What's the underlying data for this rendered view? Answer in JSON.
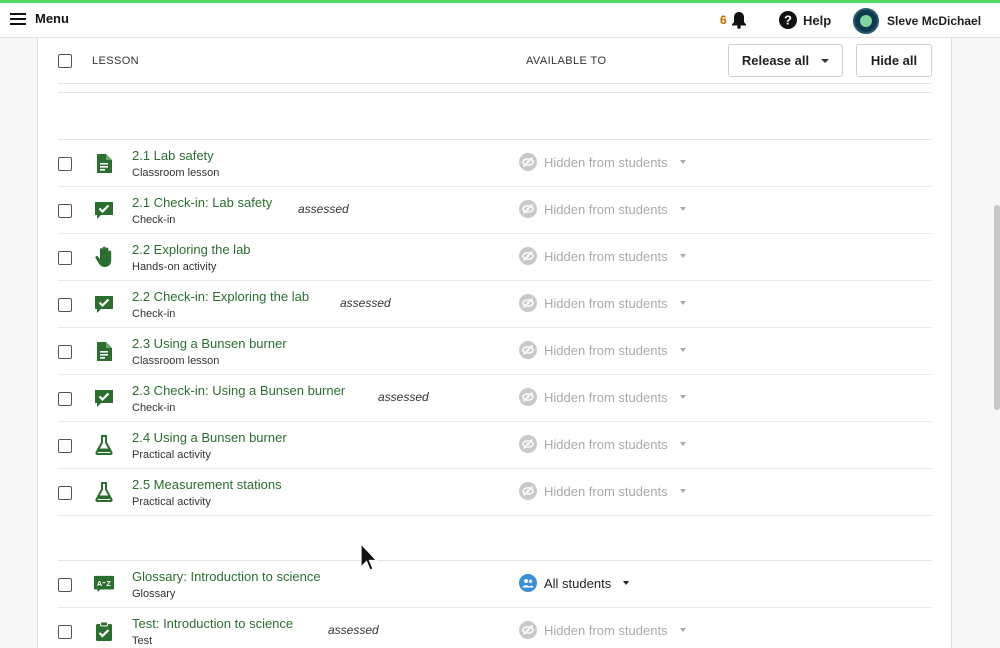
{
  "topbar": {
    "menu_label": "Menu",
    "notification_count": "6",
    "help_label": "Help",
    "user_name": "Sleve McDichael"
  },
  "table": {
    "col_lesson": "LESSON",
    "col_available": "AVAILABLE TO",
    "release_all_label": "Release all",
    "hide_all_label": "Hide all"
  },
  "rows": [
    {
      "title": "2.1 Lab safety",
      "subtitle": "Classroom lesson",
      "icon": "document-icon",
      "assessed": "",
      "status": "Hidden from students"
    },
    {
      "title": "2.1 Check-in: Lab safety",
      "subtitle": "Check-in",
      "icon": "check-in-icon",
      "assessed": "assessed",
      "status": "Hidden from students"
    },
    {
      "title": "2.2 Exploring the lab",
      "subtitle": "Hands-on activity",
      "icon": "hand-icon",
      "assessed": "",
      "status": "Hidden from students"
    },
    {
      "title": "2.2 Check-in: Exploring the lab",
      "subtitle": "Check-in",
      "icon": "check-in-icon",
      "assessed": "assessed",
      "status": "Hidden from students"
    },
    {
      "title": "2.3 Using a Bunsen burner",
      "subtitle": "Classroom lesson",
      "icon": "document-icon",
      "assessed": "",
      "status": "Hidden from students"
    },
    {
      "title": "2.3 Check-in: Using a Bunsen burner",
      "subtitle": "Check-in",
      "icon": "check-in-icon",
      "assessed": "assessed",
      "status": "Hidden from students"
    },
    {
      "title": "2.4 Using a Bunsen burner",
      "subtitle": "Practical activity",
      "icon": "flask-icon",
      "assessed": "",
      "status": "Hidden from students"
    },
    {
      "title": "2.5 Measurement stations",
      "subtitle": "Practical activity",
      "icon": "flask-icon",
      "assessed": "",
      "status": "Hidden from students"
    },
    {
      "title": "Glossary: Introduction to science",
      "subtitle": "Glossary",
      "icon": "glossary-icon",
      "assessed": "",
      "status": "All students"
    },
    {
      "title": "Test: Introduction to science",
      "subtitle": "Test",
      "icon": "test-clipboard-icon",
      "assessed": "assessed",
      "status": "Hidden from students"
    }
  ],
  "colors": {
    "accent_green": "#2c6e2f",
    "topbar_stripe": "#4cd964",
    "notification": "#c26a00",
    "all_students_blue": "#3a8fd4"
  }
}
